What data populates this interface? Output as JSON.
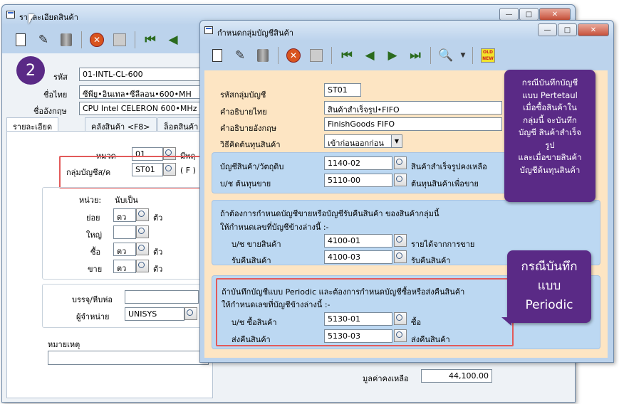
{
  "back_window": {
    "title": "รายละเอียดสินค้า",
    "step_number": "2",
    "fields": {
      "code_label": "รหัส",
      "code_value": "01-INTL-CL-600",
      "thai_name_label": "ชื่อไทย",
      "thai_name_value": "ซีพียู•อินเทล•ซีลีลอน•600•MH",
      "eng_name_label": "ชื่ออังกฤษ",
      "eng_name_value": "CPU Intel CELERON 600•MHz",
      "category_label": "หมวด",
      "category_value": "01",
      "category_suffix": "มีพฤ",
      "account_group_label": "กลุ่มบัญชีส/ค",
      "account_group_value": "ST01",
      "account_group_suffix": "( F )",
      "unit_header": "หน่วย:",
      "unit_header_value": "นับเป็น",
      "unit_small_label": "ย่อย",
      "unit_small_value": "ตว",
      "unit_small_suffix": "ตัว",
      "unit_large_label": "ใหญ่",
      "unit_large_value": "",
      "unit_buy_label": "ซื้อ",
      "unit_buy_value": "ตว",
      "unit_buy_suffix": "ตัว",
      "unit_sell_label": "ขาย",
      "unit_sell_value": "ตว",
      "unit_sell_suffix": "ตัว",
      "package_label": "บรรจุ/หีบห่อ",
      "package_value": "",
      "supplier_label": "ผู้จำหน่าย",
      "supplier_value": "UNISYS",
      "note_label": "หมายเหตุ",
      "note_value": "",
      "balance_label": "มูลค่าคงเหลือ",
      "balance_value": "44,100.00"
    },
    "tabs": [
      "รายละเอียด",
      "คลังสินค้า <F8>",
      "ล็อตสินค้า"
    ]
  },
  "front_window": {
    "title": "กำหนดกลุ่มบัญชีสินค้า",
    "group_code_label": "รหัสกลุ่มบัญชี",
    "group_code_value": "ST01",
    "desc_thai_label": "คำอธิบายไทย",
    "desc_thai_value": "สินค้าสำเร็จรูป•FIFO",
    "desc_eng_label": "คำอธิบายอังกฤษ",
    "desc_eng_value": "FinishGoods FIFO",
    "cost_method_label": "วิธีคิดต้นทุนสินค้า",
    "cost_method_value": "เข้าก่อนออกก่อน",
    "section1": {
      "rows": [
        {
          "label": "บัญชีสินค้า/วัตถุดิบ",
          "value": "1140-02",
          "desc": "สินค้าสำเร็จรูปคงเหลือ"
        },
        {
          "label": "บ/ช ต้นทุนขาย",
          "value": "5110-00",
          "desc": "ต้นทุนสินค้าเพื่อขาย"
        }
      ]
    },
    "section2": {
      "line1": "ถ้าต้องการกำหนดบัญชีขายหรือบัญชีรับคืนสินค้า ของสินค้ากลุ่มนี้",
      "line2": "ให้กำหนดเลขที่บัญชีข้างล่างนี้ :-",
      "rows": [
        {
          "label": "บ/ช ขายสินค้า",
          "value": "4100-01",
          "desc": "รายได้จากการขาย"
        },
        {
          "label": "รับคืนสินค้า",
          "value": "4100-03",
          "desc": "รับคืนสินค้า"
        }
      ]
    },
    "section3": {
      "line1": "ถ้าบันทึกบัญชีแบบ Periodic และต้องการกำหนดบัญชีซื้อหรือส่งคืนสินค้า",
      "line2": "ให้กำหนดเลขที่บัญชีข้างล่างนี้ :-",
      "rows": [
        {
          "label": "บ/ช ซื้อสินค้า",
          "value": "5130-01",
          "desc": "ซื้อ"
        },
        {
          "label": "ส่งคืนสินค้า",
          "value": "5130-03",
          "desc": "ส่งคืนสินค้า"
        }
      ]
    }
  },
  "callouts": {
    "perpetual": [
      "กรณีบันทึกบัญชี",
      "แบบ Pertetaul",
      "เมื่อซื้อสินค้าใน",
      "กลุ่มนี้ จะบันทึก",
      "บัญชี สินค้าสำเร็จ",
      "รูป",
      "และเมื่อขายสินค้า",
      "บัญชีต้นทุนสินค้า"
    ],
    "periodic": [
      "กรณีบันทึก",
      "แบบ",
      "Periodic"
    ]
  },
  "colors": {
    "callout": "#5a2a86",
    "highlight": "#e25a5a",
    "panel": "#fde5c3",
    "group": "#bcd8f2"
  },
  "icons": [
    "new-icon",
    "edit-icon",
    "delete-icon",
    "cancel-icon",
    "save-icon",
    "first-icon",
    "prev-icon",
    "next-icon",
    "last-icon",
    "search-icon",
    "oldnew-icon"
  ]
}
